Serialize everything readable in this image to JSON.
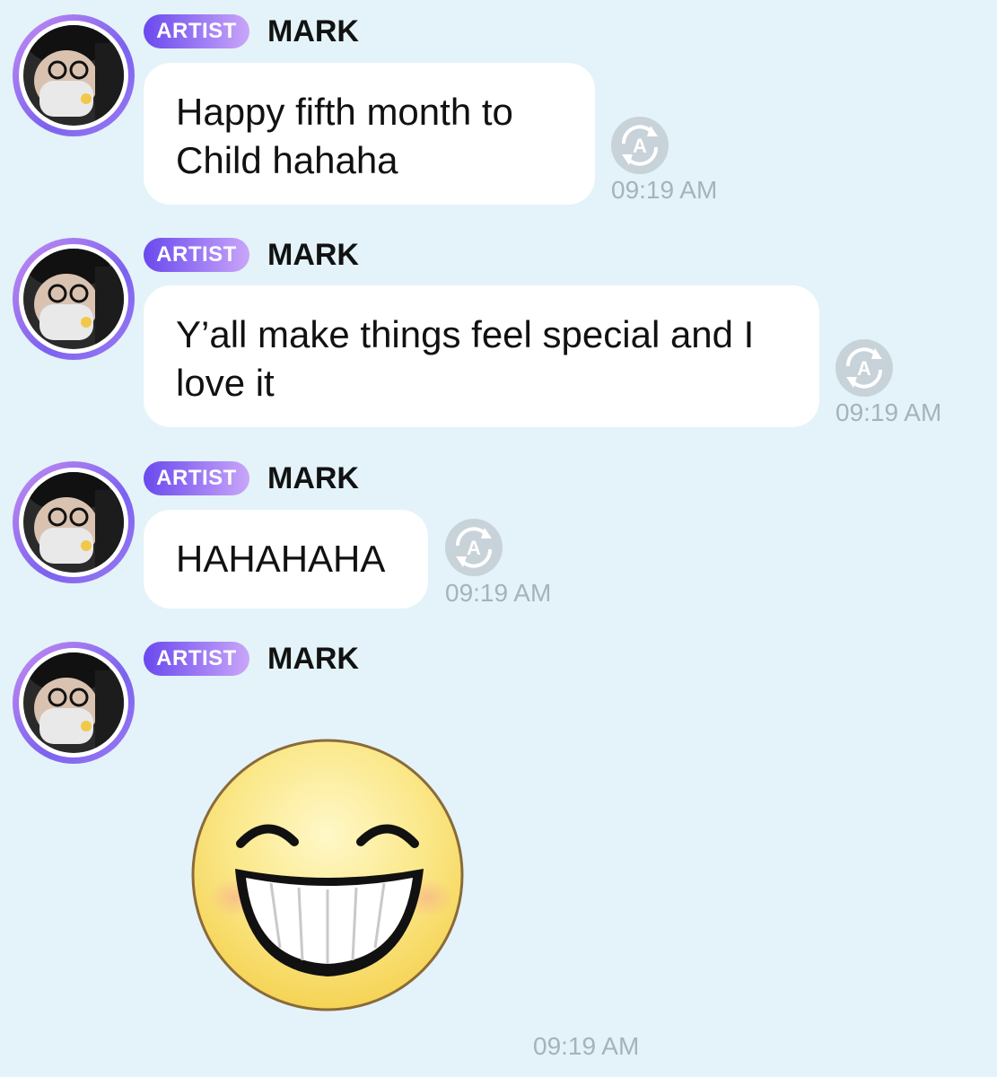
{
  "messages": [
    {
      "badge": "ARTIST",
      "name": "MARK",
      "text": "Happy fifth month to Child hahaha",
      "time": "09:19 AM",
      "type": "text"
    },
    {
      "badge": "ARTIST",
      "name": "MARK",
      "text": "Y’all make things feel special and I love it",
      "time": "09:19 AM",
      "type": "text"
    },
    {
      "badge": "ARTIST",
      "name": "MARK",
      "text": "HAHAHAHA",
      "time": "09:19 AM",
      "type": "text"
    },
    {
      "badge": "ARTIST",
      "name": "MARK",
      "sticker": "laughing-emoji",
      "time": "09:19 AM",
      "type": "sticker"
    }
  ],
  "colors": {
    "background": "#e3f3f9",
    "bubble": "#ffffff",
    "badge_start": "#6a49ee",
    "badge_end": "#c9a6f9",
    "timestamp": "#a6b3b9"
  },
  "icons": {
    "translate": "translate-icon",
    "avatar": "artist-avatar"
  }
}
